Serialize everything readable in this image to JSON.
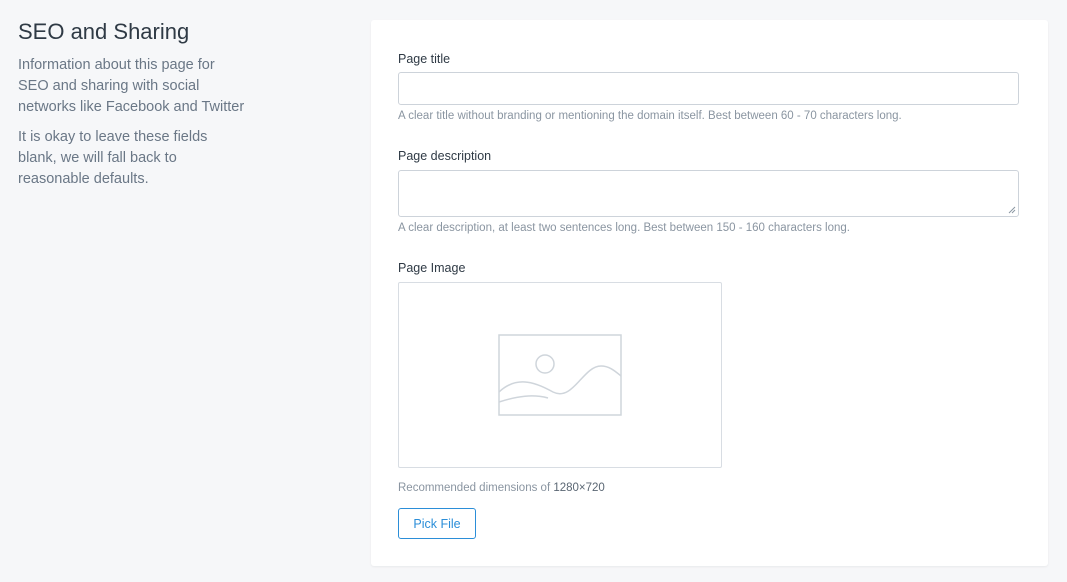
{
  "section": {
    "title": "SEO and Sharing",
    "description": "Information about this page for SEO and sharing with social networks like Facebook and Twitter",
    "note": "It is okay to leave these fields blank, we will fall back to reasonable defaults."
  },
  "form": {
    "page_title": {
      "label": "Page title",
      "value": "",
      "placeholder": "",
      "help": "A clear title without branding or mentioning the domain itself. Best between 60 - 70 characters long."
    },
    "page_description": {
      "label": "Page description",
      "value": "",
      "placeholder": "",
      "help": "A clear description, at least two sentences long. Best between 150 - 160 characters long."
    },
    "page_image": {
      "label": "Page Image",
      "placeholder_icon": "image-placeholder-icon",
      "recommended_prefix": "Recommended dimensions of",
      "recommended_value": "1280×720",
      "button_label": "Pick File"
    }
  },
  "colors": {
    "accent": "#2b8ed8",
    "background": "#f6f7f9",
    "card": "#ffffff"
  }
}
